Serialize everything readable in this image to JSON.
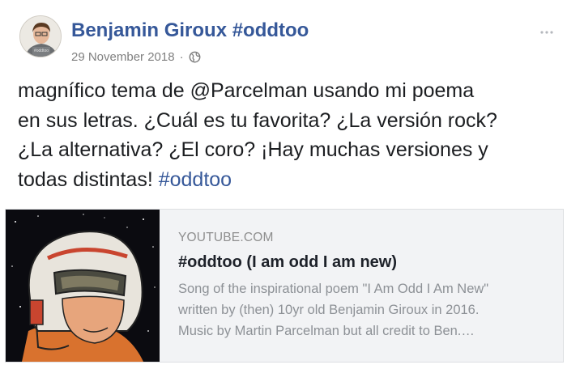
{
  "post": {
    "author": "Benjamin Giroux #oddtoo",
    "date": "29 November 2018",
    "separator": "·",
    "privacy_icon": "globe-icon",
    "avatar_shirt_text": "#oddtoo",
    "text": "magnífico tema de @Parcelman usando mi poema\nen sus letras. ¿Cuál es tu favorita? ¿La versión rock?\n¿La alternativa? ¿El coro? ¡Hay muchas versiones y\ntodas distintas! ",
    "hashtag": "#oddtoo"
  },
  "link_preview": {
    "domain": "YOUTUBE.COM",
    "title": "#oddtoo (I am odd I am new)",
    "description": [
      "Song of the inspirational poem \"I Am Odd I Am New\"",
      "written by (then) 10yr old Benjamin Giroux in 2016.",
      "Music by Martin Parcelman but all credit to Ben.…"
    ]
  },
  "colors": {
    "link": "#365899",
    "meta": "#7f7f7f",
    "card_bg": "#f2f3f5",
    "card_border": "#dddfe2"
  }
}
